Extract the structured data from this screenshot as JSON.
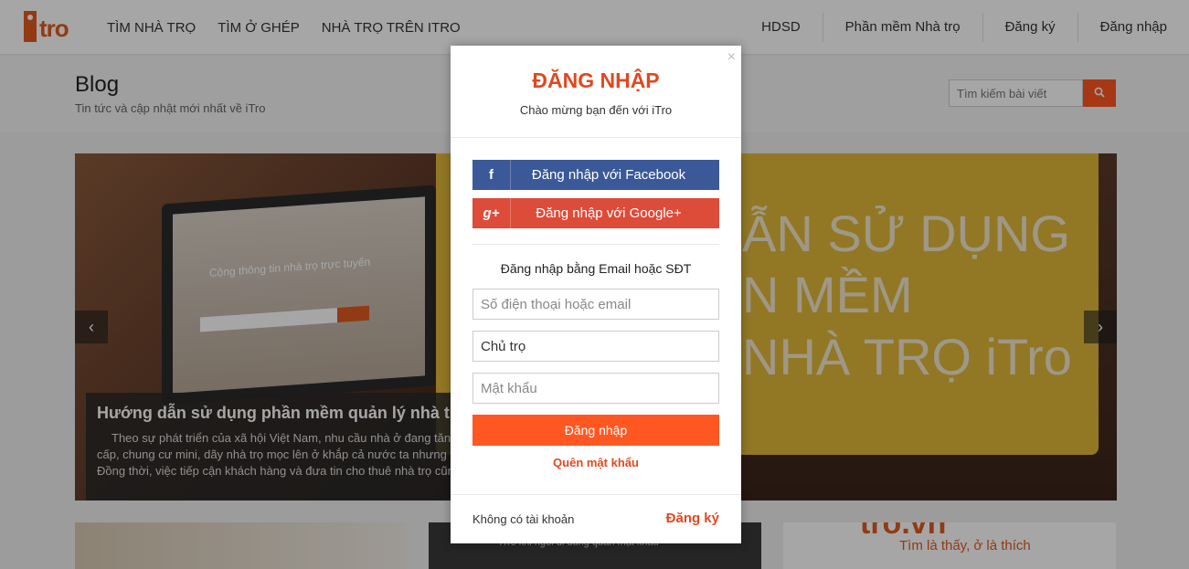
{
  "brand": {
    "logo_text": "tro",
    "accent": "#e05a1e"
  },
  "nav": {
    "left": [
      "TÌM NHÀ TRỌ",
      "TÌM Ở GHÉP",
      "NHÀ TRỌ TRÊN ITRO"
    ],
    "right": [
      "HDSD",
      "Phần mềm Nhà trọ",
      "Đăng ký",
      "Đăng nhập"
    ]
  },
  "blog": {
    "title": "Blog",
    "subtitle": "Tin tức và cập nhật mới nhất về iTro",
    "search_placeholder": "Tìm kiếm bài viết",
    "search_icon": "search-icon"
  },
  "slider": {
    "laptop_text": "Cộng thông tin nhà trọ trực tuyến",
    "banner_lines": [
      "ẪN SỬ DỤNG",
      "N MỀM",
      "NHÀ TRỌ iTro"
    ],
    "caption_title": "Hướng dẫn sử dụng phần mềm quản lý nhà trọ iT",
    "caption_lines": [
      "Theo sự phát triển của xã hội Việt Nam, nhu cầu nhà ở đang tăng",
      "cấp, chung cư mini, dãy nhà trọ mọc lên ở khắp cả nước ta nhưng vẫ",
      "Đồng thời, việc tiếp cận khách hàng và đưa tin cho thuê nhà trọ cũng"
    ],
    "prev_icon": "chevron-left-icon",
    "next_icon": "chevron-right-icon"
  },
  "cards": {
    "card2_text": "iTro khi ngồi đi dùng quản mặt khẩu",
    "card3_logo": "tro.vn",
    "card3_slogan": "Tìm là thấy, ở là thích"
  },
  "modal": {
    "title": "ĐĂNG NHẬP",
    "subtitle": "Chào mừng bạn đến với iTro",
    "facebook_label": "Đăng nhập với Facebook",
    "google_label": "Đăng nhập với Google+",
    "email_section_title": "Đăng nhập bằng Email hoặc SĐT",
    "phone_placeholder": "Số điện thoại hoặc email",
    "role_value": "Chủ trọ",
    "password_placeholder": "Mật khẩu",
    "login_button": "Đăng nhập",
    "forgot_password": "Quên mật khẩu",
    "no_account": "Không có tài khoản",
    "register_link": "Đăng ký",
    "colors": {
      "facebook": "#3b5998",
      "google": "#dd4b39",
      "primary": "#ff5722"
    }
  }
}
